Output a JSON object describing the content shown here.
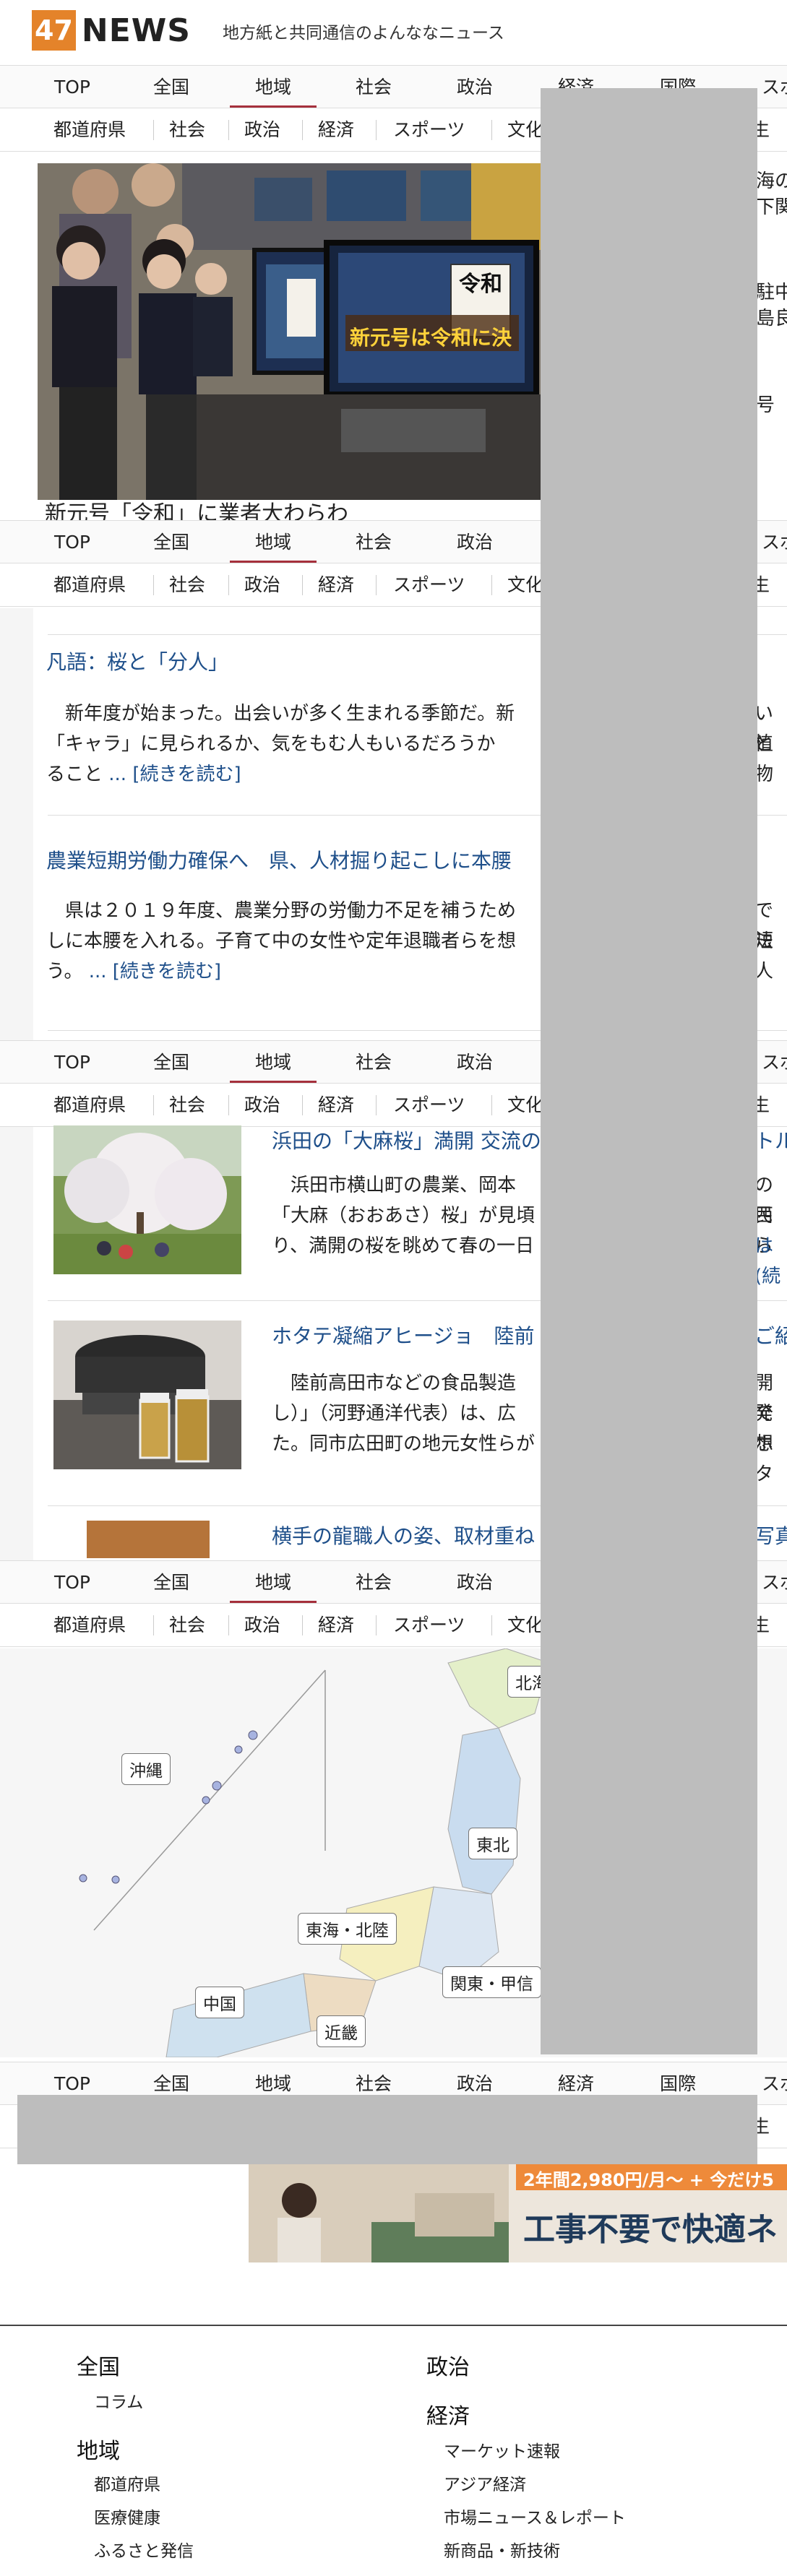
{
  "header": {
    "logo_num": "47",
    "logo_word": "NEWS",
    "tagline": "地方紙と共同通信のよんななニュース"
  },
  "nav": {
    "items": [
      "TOP",
      "全国",
      "地域",
      "社会",
      "政治",
      "経済",
      "国際",
      "スポ"
    ],
    "active": "地域"
  },
  "subnav": {
    "items": [
      "都道府県",
      "社会",
      "政治",
      "経済",
      "スポーツ",
      "文化",
      "生"
    ]
  },
  "hero": {
    "caption": "新元号「令和」に業者大わらわ",
    "sign": "令和",
    "screen_text": "新元号は令和に決",
    "right_snippets": [
      "海の",
      "下関",
      "駐中",
      "島良",
      "号"
    ]
  },
  "articles": [
    {
      "title": "凡語：桜と「分人」",
      "body": "　新年度が始まった。出会いが多く生まれる季節だ。新",
      "body2": "「キャラ」に見られるか、気をもむ人もいるだろうか",
      "body3": "ること",
      "more": "... [続きを読む]",
      "right1": "いと",
      "right2": "植物"
    },
    {
      "title": "農業短期労働力確保へ　県、人材掘り起こしに本腰",
      "body": "　県は２０１９年度、農業分野の労働力不足を補うため",
      "body2": "しに本腰を入れる。子育て中の女性や定年退職者らを想",
      "body3": "う。",
      "more": "... [続きを読む]",
      "right1": "で短",
      "right2": "法人"
    }
  ],
  "thumbs": [
    {
      "title": "浜田の「大麻桜」満開 交流の",
      "t_right": "トル",
      "lines": [
        "　浜田市横山町の農業、岡本",
        "「大麻（おおあさ）桜」が見頃",
        "り、満開の桜を眺めて春の一日"
      ],
      "r": [
        "の西",
        "民ら",
        "は(続"
      ]
    },
    {
      "title": "ホタテ凝縮アヒージョ　陸前",
      "t_right": "ご紹",
      "lines": [
        "　陸前高田市などの食品製造",
        "し）」（河野通洋代表）は、広",
        "た。同市広田町の地元女性らが"
      ],
      "r": [
        "開発",
        "で想",
        "ホタ"
      ]
    },
    {
      "title": "横手の龍職人の姿、取材重ね",
      "t_right": "写真"
    }
  ],
  "map": {
    "regions": [
      "北海",
      "沖縄",
      "東北",
      "東海・北陸",
      "関東・甲信",
      "中国",
      "近畿"
    ]
  },
  "ad": {
    "headline": "工事不要で快適ネ",
    "badge": "2年間2,980円/月～ + 今だけ5"
  },
  "footer": {
    "left": [
      {
        "h": "全国",
        "items": [
          "コラム"
        ]
      },
      {
        "h": "地域",
        "items": [
          "都道府県",
          "医療健康",
          "ふるさと発信"
        ]
      }
    ],
    "right": [
      {
        "h": "政治",
        "items": []
      },
      {
        "h": "経済",
        "items": [
          "マーケット速報",
          "アジア経済",
          "市場ニュース＆レポート",
          "新商品・新技術"
        ]
      }
    ]
  },
  "colors": {
    "accent": "#a5303c",
    "logo": "#e4832a",
    "link": "#1e4f8a",
    "redaction": "#bdbdbd"
  }
}
